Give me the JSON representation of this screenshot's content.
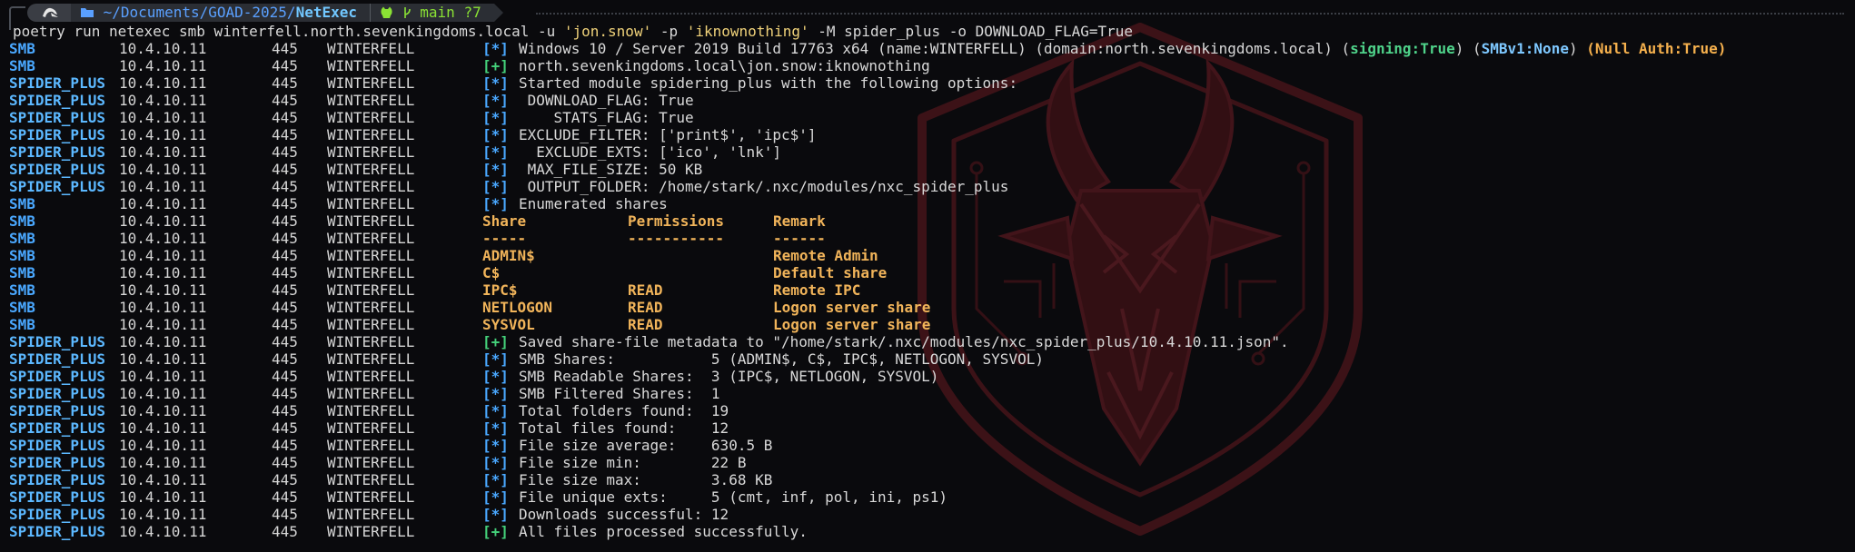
{
  "prompt": {
    "os_icon": "tux-penguin-icon",
    "path_prefix": "~/Documents/GOAD-2025/",
    "path_leaf": "NetExec",
    "git_text": "main ?7",
    "git_icon": "github-cat-icon",
    "branch_icon": "git-branch-icon"
  },
  "command": {
    "base": "poetry run netexec smb winterfell.north.sevenkingdoms.local -u ",
    "user": "'jon.snow'",
    "mid": " -p ",
    "pass": "'iknownothing'",
    "tail": " -M spider_plus -o DOWNLOAD_FLAG=True"
  },
  "common": {
    "ip": "10.4.10.11",
    "port": "445",
    "host": "WINTERFELL",
    "tag_star": "[*]",
    "tag_plus": "[+]"
  },
  "first_line": {
    "proto": "SMB",
    "text": "Windows 10 / Server 2019 Build 17763 x64 (name:WINTERFELL) (domain:north.sevenkingdoms.local) (",
    "signing": "signing:True",
    "mid1": ") (",
    "smbv1": "SMBv1:None",
    "mid2": ") ",
    "nullauth": "(Null Auth:True)"
  },
  "lines": [
    {
      "proto": "SMB",
      "tag": "plus",
      "msg": "north.sevenkingdoms.local\\jon.snow:iknownothing"
    },
    {
      "proto": "SPIDER_PLUS",
      "tag": "star",
      "msg": "Started module spidering_plus with the following options:"
    },
    {
      "proto": "SPIDER_PLUS",
      "tag": "star",
      "msg": " DOWNLOAD_FLAG: True"
    },
    {
      "proto": "SPIDER_PLUS",
      "tag": "star",
      "msg": "    STATS_FLAG: True"
    },
    {
      "proto": "SPIDER_PLUS",
      "tag": "star",
      "msg": "EXCLUDE_FILTER: ['print$', 'ipc$']"
    },
    {
      "proto": "SPIDER_PLUS",
      "tag": "star",
      "msg": "  EXCLUDE_EXTS: ['ico', 'lnk']"
    },
    {
      "proto": "SPIDER_PLUS",
      "tag": "star",
      "msg": " MAX_FILE_SIZE: 50 KB"
    },
    {
      "proto": "SPIDER_PLUS",
      "tag": "star",
      "msg": " OUTPUT_FOLDER: /home/stark/.nxc/modules/nxc_spider_plus"
    },
    {
      "proto": "SMB",
      "tag": "star",
      "msg": "Enumerated shares"
    }
  ],
  "shares_header": {
    "share": "Share",
    "perm": "Permissions",
    "remark": "Remark"
  },
  "shares_sep": {
    "share": "-----",
    "perm": "-----------",
    "remark": "------"
  },
  "shares": [
    {
      "share": "ADMIN$",
      "perm": "",
      "remark": "Remote Admin"
    },
    {
      "share": "C$",
      "perm": "",
      "remark": "Default share"
    },
    {
      "share": "IPC$",
      "perm": "READ",
      "remark": "Remote IPC"
    },
    {
      "share": "NETLOGON",
      "perm": "READ",
      "remark": "Logon server share"
    },
    {
      "share": "SYSVOL",
      "perm": "READ",
      "remark": "Logon server share"
    }
  ],
  "summary": [
    {
      "proto": "SPIDER_PLUS",
      "tag": "plus",
      "msg": "Saved share-file metadata to \"/home/stark/.nxc/modules/nxc_spider_plus/10.4.10.11.json\"."
    },
    {
      "proto": "SPIDER_PLUS",
      "tag": "star",
      "msg": "SMB Shares:           5 (ADMIN$, C$, IPC$, NETLOGON, SYSVOL)"
    },
    {
      "proto": "SPIDER_PLUS",
      "tag": "star",
      "msg": "SMB Readable Shares:  3 (IPC$, NETLOGON, SYSVOL)"
    },
    {
      "proto": "SPIDER_PLUS",
      "tag": "star",
      "msg": "SMB Filtered Shares:  1"
    },
    {
      "proto": "SPIDER_PLUS",
      "tag": "star",
      "msg": "Total folders found:  19"
    },
    {
      "proto": "SPIDER_PLUS",
      "tag": "star",
      "msg": "Total files found:    12"
    },
    {
      "proto": "SPIDER_PLUS",
      "tag": "star",
      "msg": "File size average:    630.5 B"
    },
    {
      "proto": "SPIDER_PLUS",
      "tag": "star",
      "msg": "File size min:        22 B"
    },
    {
      "proto": "SPIDER_PLUS",
      "tag": "star",
      "msg": "File size max:        3.68 KB"
    },
    {
      "proto": "SPIDER_PLUS",
      "tag": "star",
      "msg": "File unique exts:     5 (cmt, inf, pol, ini, ps1)"
    },
    {
      "proto": "SPIDER_PLUS",
      "tag": "star",
      "msg": "Downloads successful: 12"
    },
    {
      "proto": "SPIDER_PLUS",
      "tag": "plus",
      "msg": "All files processed successfully."
    }
  ],
  "colors": {
    "background": "#0a0a0d",
    "watermark": "#6e1b22",
    "blue": "#4aa8ff",
    "green": "#44d17a",
    "orange": "#f1b45a"
  },
  "watermark_icon": "goat-shield-emblem-icon"
}
